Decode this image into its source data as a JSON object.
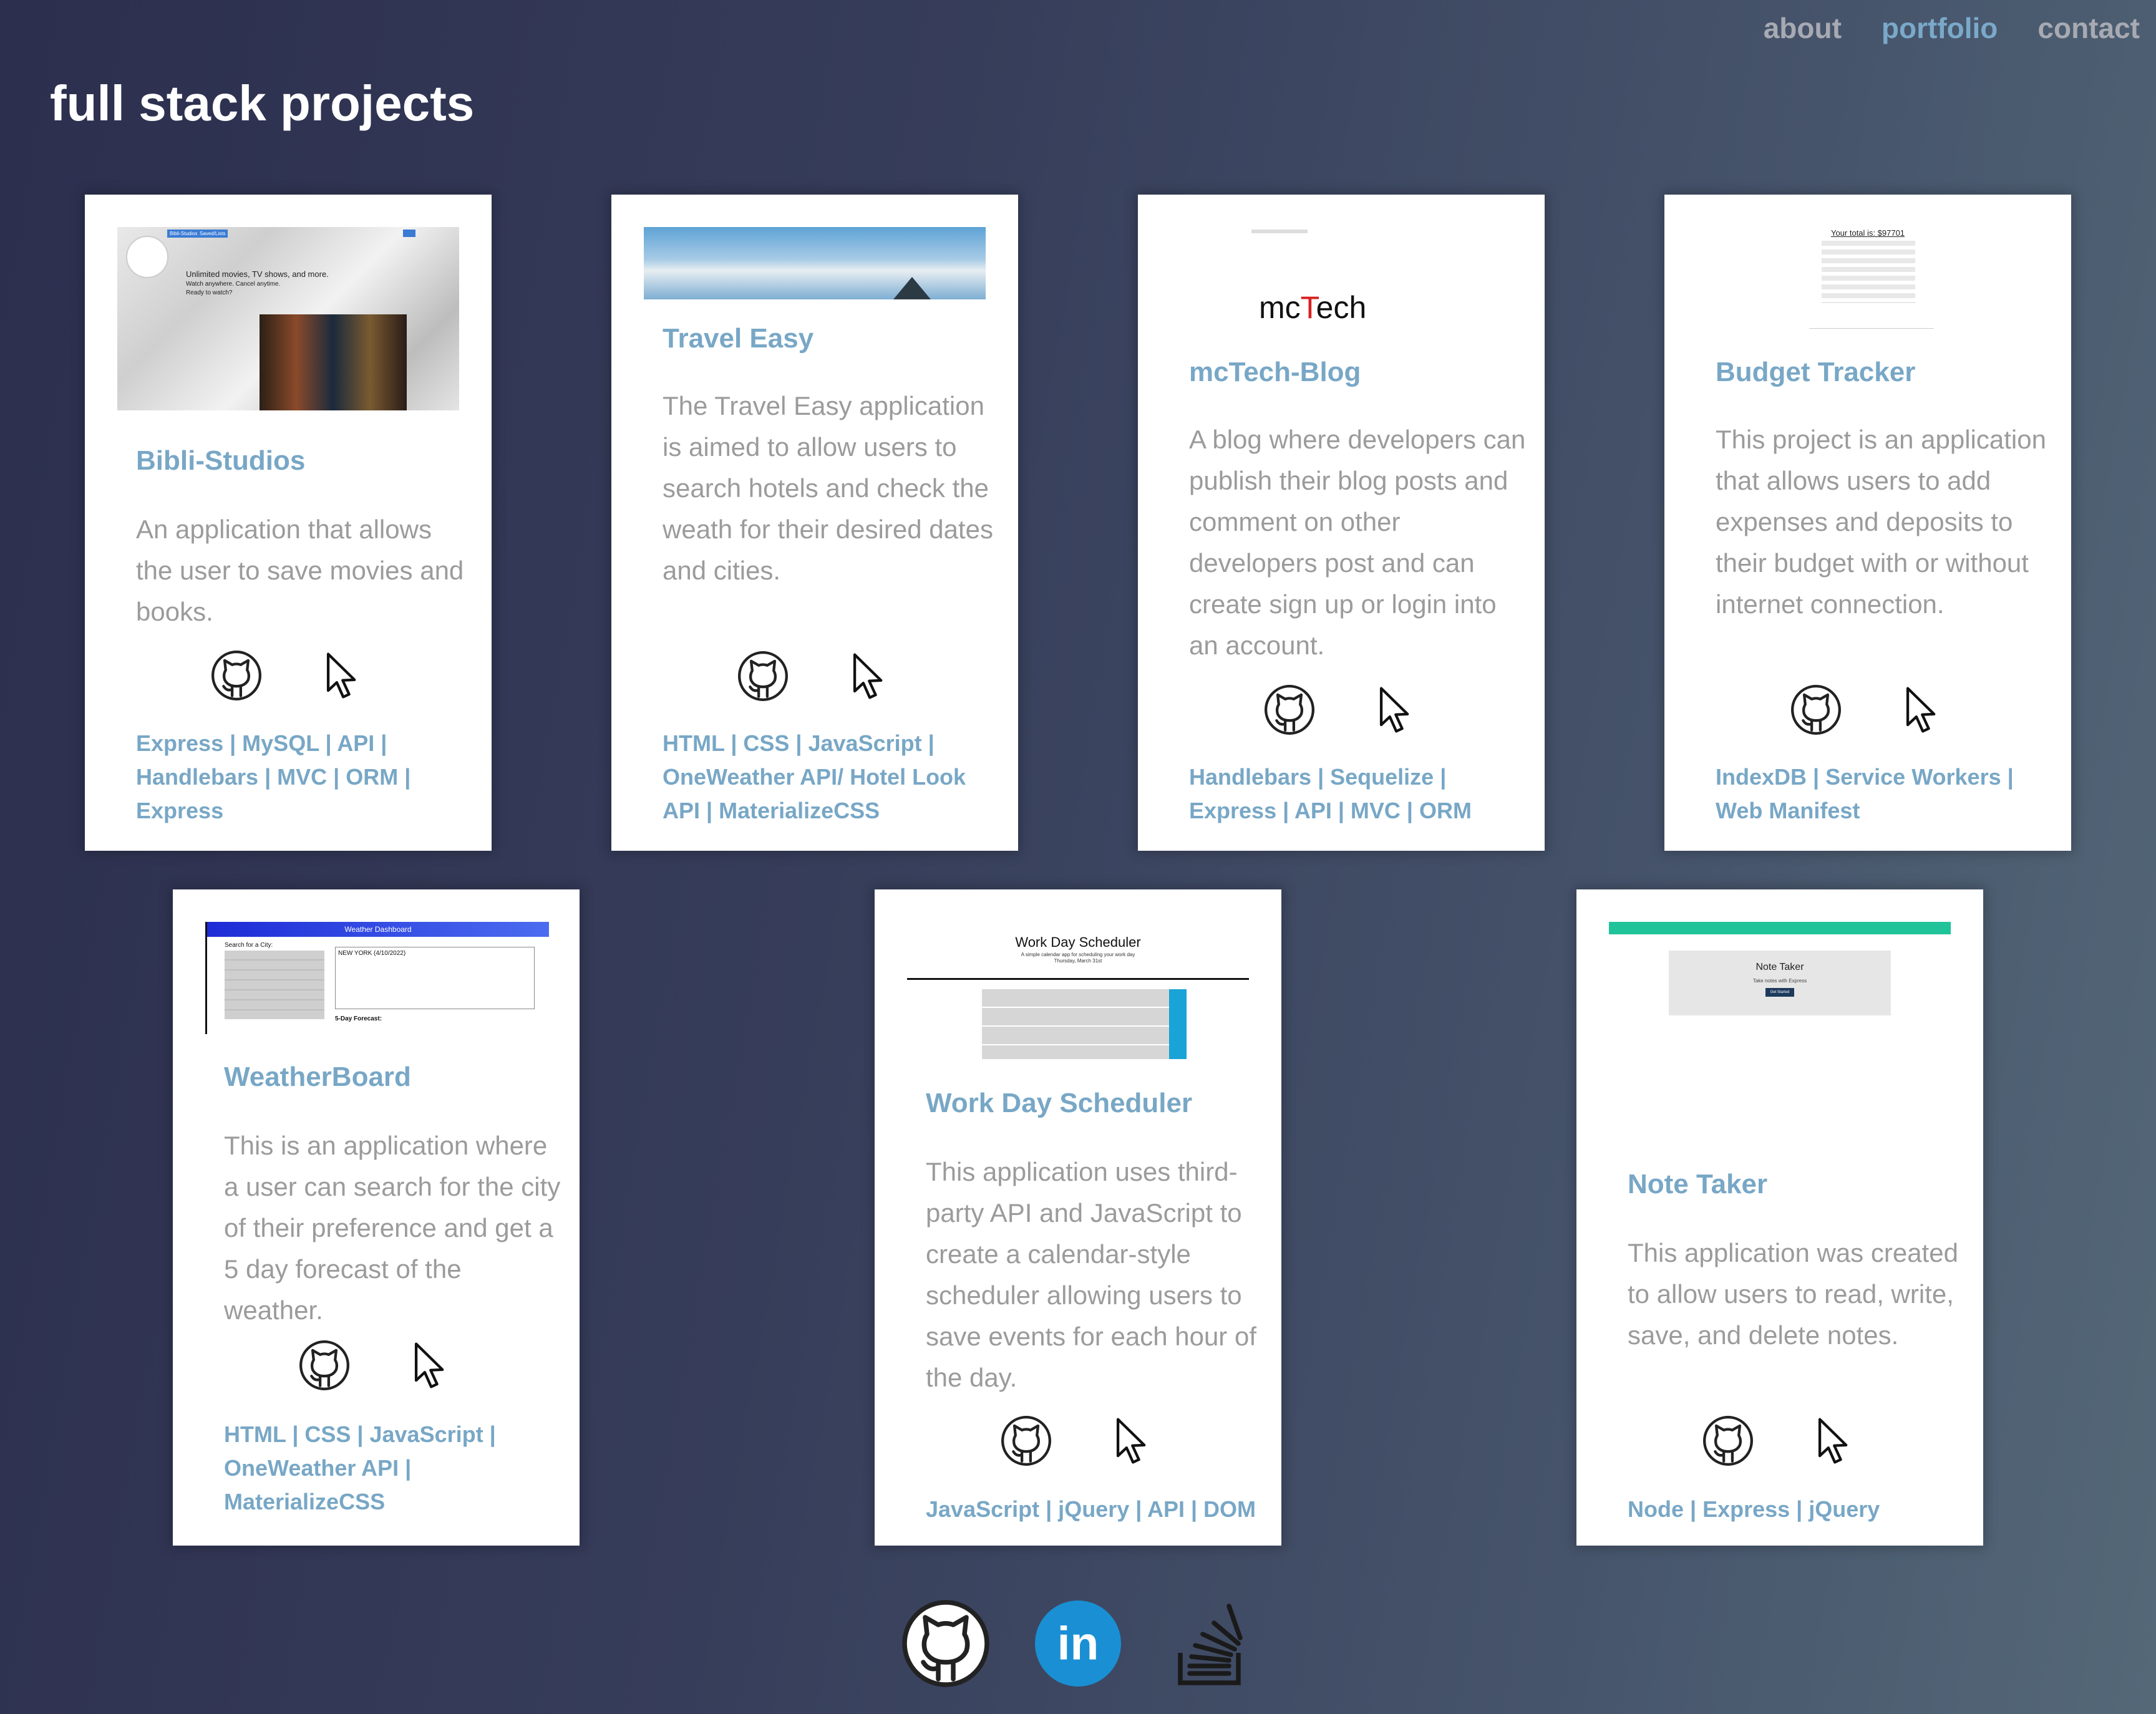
{
  "nav": {
    "about": "about",
    "portfolio": "portfolio",
    "contact": "contact"
  },
  "page_title": "full stack projects",
  "colors": {
    "accent": "#78a7c6",
    "nav_active": "#7aa9c9",
    "nav_inactive": "#a7aab3",
    "text_muted": "#9b9b9b",
    "card_bg": "#ffffff"
  },
  "projects": [
    {
      "title": "Bibli-Studios",
      "description": "An application that allows the user to save movies and books.",
      "tech": "Express | MySQL | API | Handlebars | MVC | ORM | Express",
      "icons": [
        "github-icon",
        "cursor-icon"
      ],
      "preview": {
        "nav1": "Bibli-Studios",
        "nav2": "Saved/Lists",
        "line1": "Unlimited movies, TV shows, and more.",
        "line2": "Watch anywhere. Cancel anytime.",
        "line3": "Ready to watch?"
      }
    },
    {
      "title": "Travel Easy",
      "description": "The Travel Easy application is aimed to allow users to search hotels and check the weath for their desired dates and cities.",
      "tech": "HTML | CSS | JavaScript | OneWeather API/ Hotel Look API | MaterializeCSS",
      "icons": [
        "github-icon",
        "cursor-icon"
      ]
    },
    {
      "title": "mcTech-Blog",
      "description": "A blog where developers can publish their blog posts and comment on other developers post and can create sign up or login into an account.",
      "tech": "Handlebars | Sequelize | Express | API | MVC | ORM",
      "icons": [
        "github-icon",
        "cursor-icon"
      ],
      "preview": {
        "logo_a": "mc",
        "logo_b": "T",
        "logo_c": "ech"
      }
    },
    {
      "title": "Budget Tracker",
      "description": "This project is an application that allows users to add expenses and deposits to their budget with or without internet connection.",
      "tech": "IndexDB | Service Workers | Web Manifest",
      "icons": [
        "github-icon",
        "cursor-icon"
      ],
      "preview": {
        "total": "Your total is: $97701"
      }
    },
    {
      "title": "WeatherBoard",
      "description": "This is an application where a user can search for the city of their preference and get a 5 day forecast of the weather.",
      "tech": "HTML | CSS | JavaScript | OneWeather API | MaterializeCSS",
      "icons": [
        "github-icon",
        "cursor-icon"
      ],
      "preview": {
        "header": "Weather Dashboard",
        "search": "Search for a City:",
        "city": "NEW YORK (4/10/2022)",
        "forecast": "5-Day Forecast:"
      }
    },
    {
      "title": "Work Day Scheduler",
      "description": "This application uses third-party API and JavaScript to create a calendar-style scheduler allowing users to save events for each hour of the day.",
      "tech": "JavaScript | jQuery | API | DOM",
      "icons": [
        "github-icon",
        "cursor-icon"
      ],
      "preview": {
        "header": "Work Day Scheduler",
        "sub": "A simple calendar app for scheduling your work day",
        "date": "Thursday, March 31st"
      }
    },
    {
      "title": "Note Taker",
      "description": "This application was created to allow users to read, write, save, and delete notes.",
      "tech": "Node | Express | jQuery",
      "icons": [
        "github-icon",
        "cursor-icon"
      ],
      "preview": {
        "header": "Note Taker",
        "sub": "Take notes with Express",
        "button": "Get Started"
      }
    }
  ],
  "footer": {
    "icons": [
      "github-icon",
      "linkedin-icon",
      "stackoverflow-icon"
    ],
    "linkedin_text": "in"
  }
}
